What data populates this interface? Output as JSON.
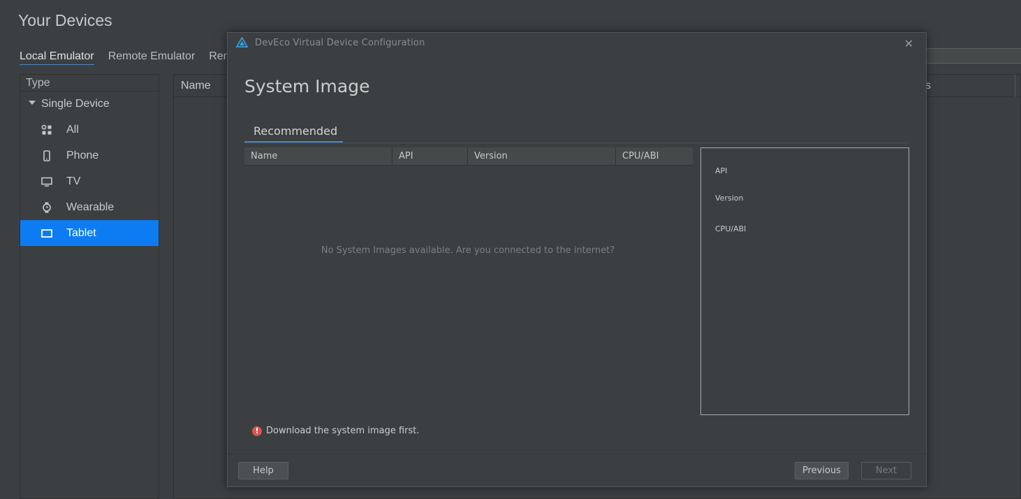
{
  "page": {
    "title": "Your Devices",
    "tabs": [
      "Local Emulator",
      "Remote Emulator",
      "Rem"
    ]
  },
  "type_panel": {
    "header": "Type",
    "group": "Single Device",
    "items": [
      {
        "label": "All",
        "icon": "grid-icon"
      },
      {
        "label": "Phone",
        "icon": "phone-icon"
      },
      {
        "label": "TV",
        "icon": "tv-icon"
      },
      {
        "label": "Wearable",
        "icon": "watch-icon"
      },
      {
        "label": "Tablet",
        "icon": "tablet-icon",
        "selected": true
      }
    ]
  },
  "device_table": {
    "col_name": "Name",
    "col_partial": "s"
  },
  "dialog": {
    "window_title": "DevEco Virtual Device Configuration",
    "heading": "System Image",
    "tab": "Recommended",
    "columns": [
      "Name",
      "API",
      "Version",
      "CPU/ABI"
    ],
    "empty_message": "No System Images available. Are you connected to the internet?",
    "details": {
      "api_label": "API",
      "version_label": "Version",
      "cpu_label": "CPU/ABI"
    },
    "error": "Download the system image first.",
    "buttons": {
      "help": "Help",
      "previous": "Previous",
      "next": "Next"
    }
  },
  "colors": {
    "background": "#3c3f41",
    "selection": "#0d7cf2",
    "accent": "#4a88c7",
    "error": "#d9534f"
  }
}
